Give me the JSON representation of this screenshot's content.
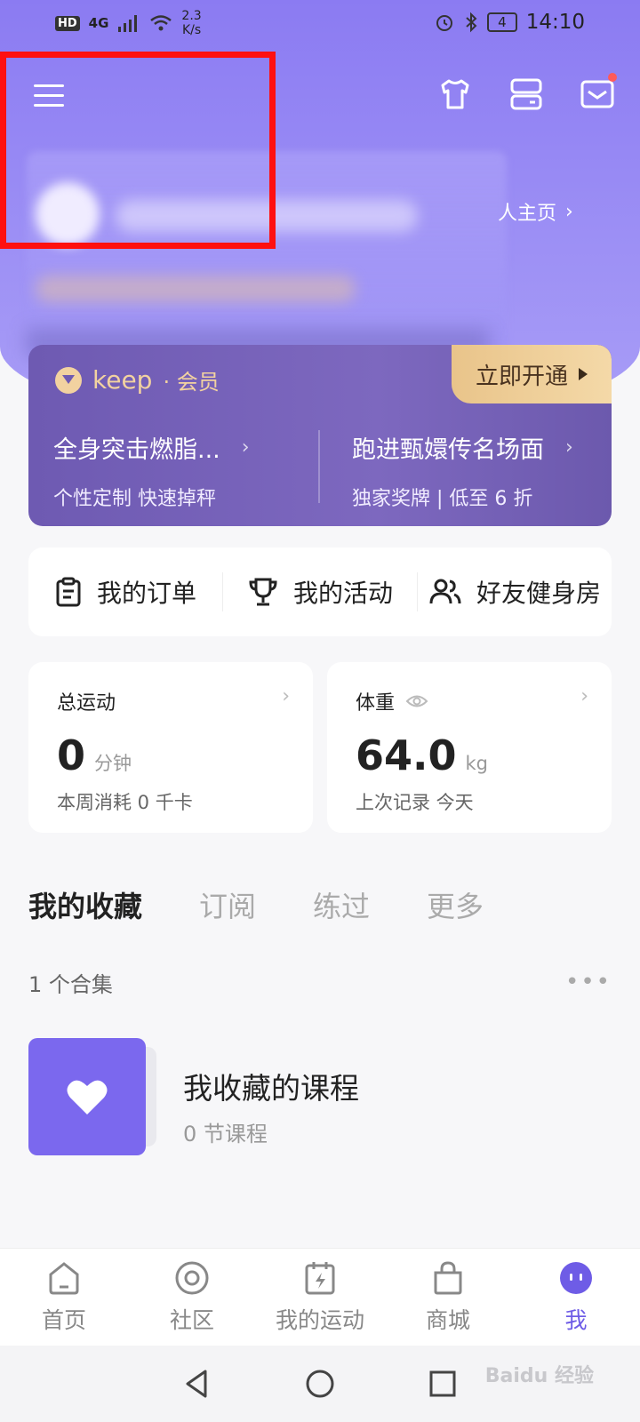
{
  "status_bar": {
    "hd": "HD",
    "network": "4G",
    "speed_value": "2.3",
    "speed_unit": "K/s",
    "battery": "4",
    "time": "14:10"
  },
  "header": {
    "homepage_link": "人主页"
  },
  "vip": {
    "logo_text": "keep",
    "logo_sub": "· 会员",
    "cta": "立即开通",
    "promos": [
      {
        "title": "全身突击燃脂...",
        "subtitle": "个性定制 快速掉秤"
      },
      {
        "title": "跑进甄嬛传名场面",
        "subtitle": "独家奖牌 | 低至 6 折"
      }
    ]
  },
  "quick_links": [
    {
      "label": "我的订单",
      "icon": "clipboard-icon"
    },
    {
      "label": "我的活动",
      "icon": "trophy-icon"
    },
    {
      "label": "好友健身房",
      "icon": "friends-icon"
    }
  ],
  "stats": {
    "exercise": {
      "label": "总运动",
      "value": "0",
      "unit": "分钟",
      "sub": "本周消耗 0 千卡"
    },
    "weight": {
      "label": "体重",
      "value": "64.0",
      "unit": "kg",
      "sub": "上次记录 今天"
    }
  },
  "tabs": [
    "我的收藏",
    "订阅",
    "练过",
    "更多"
  ],
  "collections": {
    "count": "1 个合集",
    "items": [
      {
        "title": "我收藏的课程",
        "sub": "0 节课程"
      }
    ]
  },
  "bottom_nav": [
    {
      "label": "首页",
      "icon": "home-icon"
    },
    {
      "label": "社区",
      "icon": "community-icon"
    },
    {
      "label": "我的运动",
      "icon": "calendar-bolt-icon"
    },
    {
      "label": "商城",
      "icon": "bag-icon"
    },
    {
      "label": "我",
      "icon": "me-face-icon",
      "active": true
    }
  ],
  "watermark": "Baidu 经验",
  "colors": {
    "brand_purple": "#7b68ee",
    "highlight_red": "#ff1010",
    "vip_gold": "#f2d2a0"
  }
}
